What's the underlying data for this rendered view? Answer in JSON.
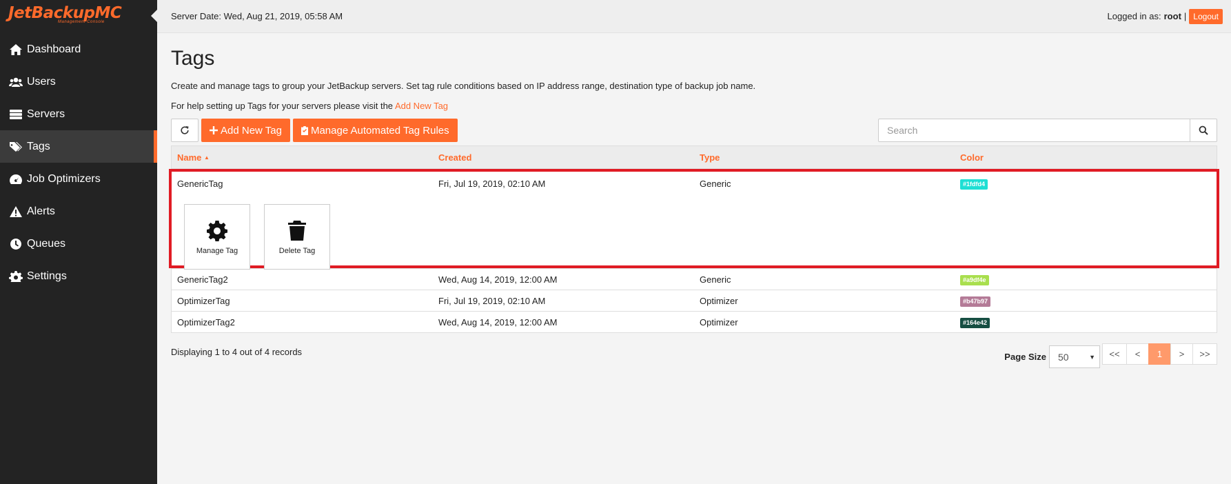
{
  "logo": {
    "brand": "JetBackupMC",
    "subtitle": "Management Console"
  },
  "sidebar": {
    "items": [
      {
        "label": "Dashboard",
        "icon": "home-icon",
        "active": false
      },
      {
        "label": "Users",
        "icon": "users-icon",
        "active": false
      },
      {
        "label": "Servers",
        "icon": "servers-icon",
        "active": false
      },
      {
        "label": "Tags",
        "icon": "tags-icon",
        "active": true
      },
      {
        "label": "Job Optimizers",
        "icon": "gauge-icon",
        "active": false
      },
      {
        "label": "Alerts",
        "icon": "warning-icon",
        "active": false
      },
      {
        "label": "Queues",
        "icon": "clock-icon",
        "active": false
      },
      {
        "label": "Settings",
        "icon": "gear-icon",
        "active": false
      }
    ]
  },
  "topbar": {
    "server_date": "Server Date: Wed, Aug 21, 2019, 05:58 AM",
    "logged_in_label": "Logged in as:",
    "username": "root",
    "separator": "|",
    "logout_label": "Logout"
  },
  "page": {
    "title": "Tags",
    "description": "Create and manage tags to group your JetBackup servers. Set tag rule conditions based on IP address range, destination type of backup job name.",
    "help_prefix": "For help setting up Tags for your servers please visit the",
    "help_link": "Add New Tag"
  },
  "toolbar": {
    "add_label": "Add New Tag",
    "rules_label": "Manage Automated Tag Rules",
    "search_placeholder": "Search"
  },
  "table": {
    "headers": [
      "Name",
      "Created",
      "Type",
      "Color"
    ],
    "sort_indicator": "▲",
    "expanded_row": {
      "name": "GenericTag",
      "created": "Fri, Jul 19, 2019, 02:10 AM",
      "type": "Generic",
      "color": "#1fdfd4",
      "actions": [
        "Manage Tag",
        "Delete Tag"
      ]
    },
    "rows": [
      {
        "name": "GenericTag2",
        "created": "Wed, Aug 14, 2019, 12:00 AM",
        "type": "Generic",
        "color": "#a9df4e"
      },
      {
        "name": "OptimizerTag",
        "created": "Fri, Jul 19, 2019, 02:10 AM",
        "type": "Optimizer",
        "color": "#b47b97"
      },
      {
        "name": "OptimizerTag2",
        "created": "Wed, Aug 14, 2019, 12:00 AM",
        "type": "Optimizer",
        "color": "#164e42"
      }
    ]
  },
  "footer": {
    "records": "Displaying 1 to 4 out of 4 records",
    "page_size_label": "Page Size",
    "page_size_value": "50",
    "pager": [
      "<<",
      "<",
      "1",
      ">",
      ">>"
    ],
    "current_page": "1"
  },
  "colors": {
    "accent": "#ff6a2b",
    "sidebar_bg": "#232323",
    "highlight_border": "#e01b24"
  }
}
